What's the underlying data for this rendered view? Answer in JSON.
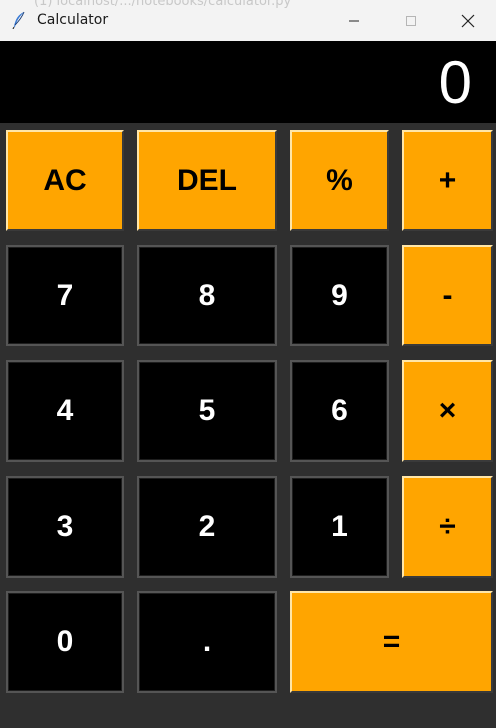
{
  "window": {
    "title": "Calculator",
    "background_text": "(1) localhost/.../notebooks/calculator.py"
  },
  "display": {
    "value": "0"
  },
  "keys": {
    "ac": "AC",
    "del": "DEL",
    "percent": "%",
    "plus": "+",
    "seven": "7",
    "eight": "8",
    "nine": "9",
    "minus": "-",
    "four": "4",
    "five": "5",
    "six": "6",
    "multiply": "×",
    "three": "3",
    "two": "2",
    "one": "1",
    "divide": "÷",
    "zero": "0",
    "dot": ".",
    "equals": "="
  },
  "colors": {
    "accent": "#ffa500",
    "display_bg": "#000000",
    "window_bg": "#2f2f2f",
    "number_key_bg": "#000000",
    "number_key_text": "#ffffff",
    "titlebar_bg": "#f3f3f3"
  },
  "icons": {
    "app": "feather-icon",
    "minimize": "minimize-icon",
    "maximize": "maximize-icon",
    "close": "close-icon"
  }
}
